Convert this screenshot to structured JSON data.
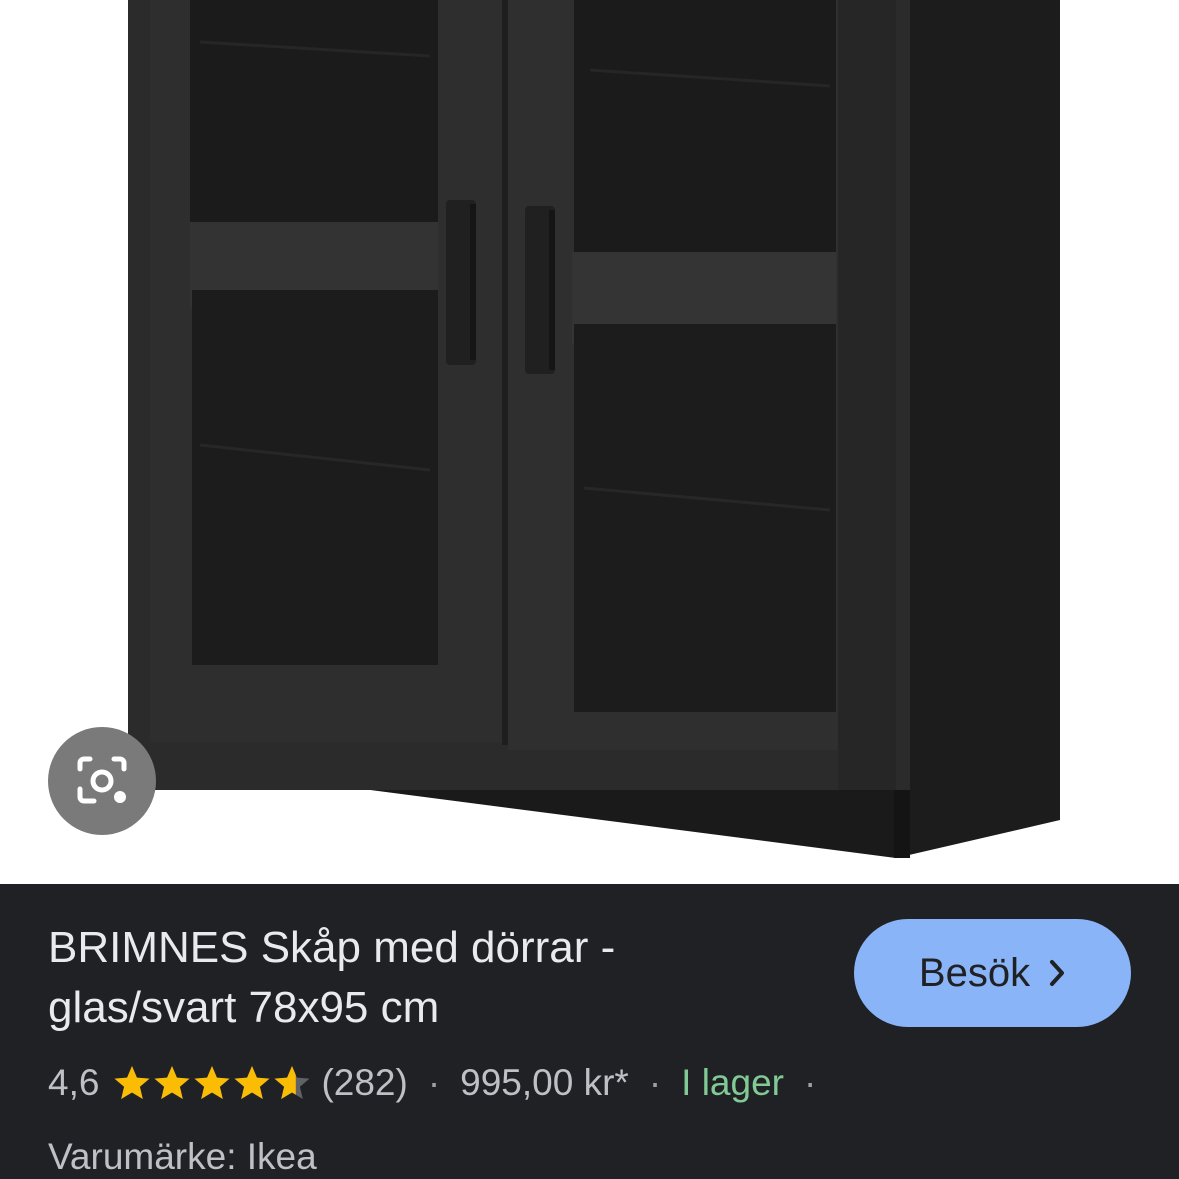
{
  "product": {
    "title": "BRIMNES Skåp med dörrar - glas/svart 78x95 cm",
    "rating": "4,6",
    "rating_value": 4.6,
    "rating_max": 5,
    "review_count": "(282)",
    "price": "995,00 kr*",
    "stock": "I lager",
    "brand": "Varumärke: Ikea"
  },
  "actions": {
    "visit_label": "Besök"
  },
  "separators": {
    "dot": "·"
  },
  "icons": {
    "lens": "camera-search-icon",
    "chevron": "chevron-right-icon",
    "star": "star-icon"
  },
  "colors": {
    "panel_bg": "#202124",
    "button_bg": "#8ab4f8",
    "star": "#fbbc04",
    "stock": "#81c995",
    "cabinet": "#2a2a2a"
  }
}
